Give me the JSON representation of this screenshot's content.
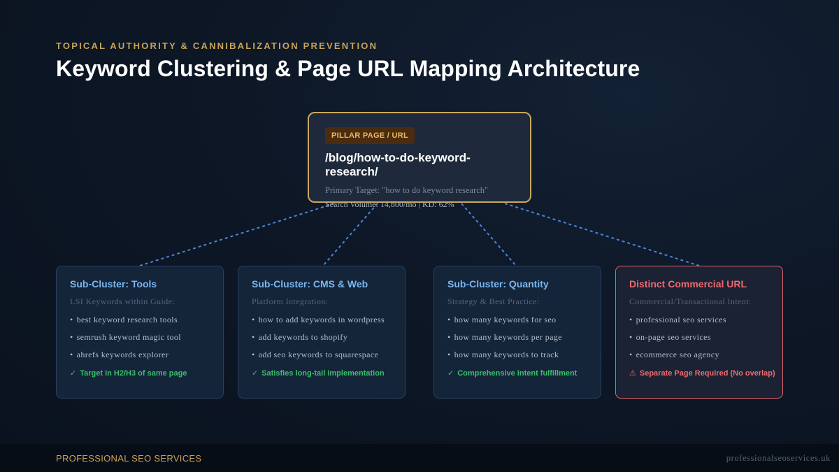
{
  "header": {
    "eyebrow": "TOPICAL AUTHORITY & CANNIBALIZATION PREVENTION",
    "title": "Keyword Clustering & Page URL Mapping Architecture"
  },
  "pillar": {
    "badge": "PILLAR PAGE / URL",
    "url": "/blog/how-to-do-keyword-research/",
    "primary_target": "Primary Target: \"how to do keyword research\"",
    "volume": "Search Volume: 14,800/mo | KD: 62%"
  },
  "clusters": [
    {
      "title": "Sub-Cluster: Tools",
      "subtitle": "LSI Keywords within Guide:",
      "items": [
        "best keyword research tools",
        "semrush keyword magic tool",
        "ahrefs keywords explorer"
      ],
      "note": "Target in H2/H3 of same page",
      "note_icon": "✓"
    },
    {
      "title": "Sub-Cluster: CMS & Web",
      "subtitle": "Platform Integration:",
      "items": [
        "how to add keywords in wordpress",
        "add keywords to shopify",
        "add seo keywords to squarespace"
      ],
      "note": "Satisfies long-tail implementation",
      "note_icon": "✓"
    },
    {
      "title": "Sub-Cluster: Quantity",
      "subtitle": "Strategy & Best Practice:",
      "items": [
        "how many keywords for seo",
        "how many keywords per page",
        "how many keywords to track"
      ],
      "note": "Comprehensive intent fulfillment",
      "note_icon": "✓"
    },
    {
      "title": "Distinct Commercial URL",
      "subtitle": "Commercial/Transactional Intent:",
      "items": [
        "professional seo services",
        "on-page seo services",
        "ecommerce seo agency"
      ],
      "note": "Separate Page Required (No overlap)",
      "note_icon": "⚠"
    }
  ],
  "footer": {
    "brand": "PROFESSIONAL SEO SERVICES",
    "site": "professionalseoservices.uk"
  },
  "colors": {
    "accent_gold": "#c9a457",
    "cluster_blue": "#7ab6ee",
    "success_green": "#3cbf6a",
    "warning_red": "#ee6a70",
    "connector_blue": "#4a86d8"
  },
  "icons": {
    "check": "check-icon",
    "warning": "warning-icon",
    "bullet": "bullet-dot-icon"
  }
}
